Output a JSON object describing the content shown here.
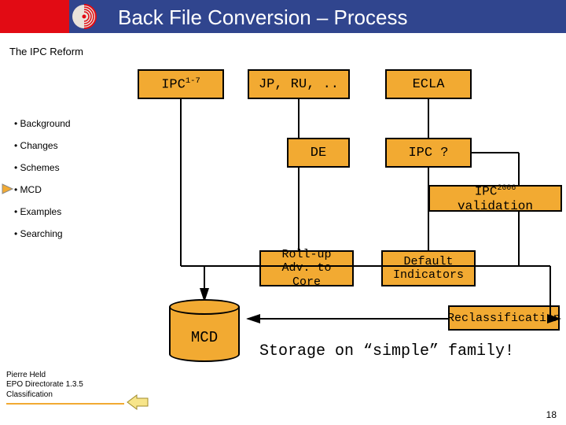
{
  "header": {
    "title": "Back File Conversion – Process",
    "subtitle": "The IPC Reform"
  },
  "sidebar": {
    "items": [
      {
        "label": "Background"
      },
      {
        "label": "Changes"
      },
      {
        "label": "Schemes"
      },
      {
        "label": "MCD"
      },
      {
        "label": "Examples"
      },
      {
        "label": "Searching"
      }
    ]
  },
  "nodes": {
    "ipc17_pre": "IPC",
    "ipc17_sup": "1-7",
    "jpru": "JP, RU, ..",
    "ecla": "ECLA",
    "de": "DE",
    "ipcq": "IPC ?",
    "ipc2006_pre": "IPC",
    "ipc2006_sup": "2006",
    "ipc2006_post": " validation",
    "rollup_l1": "Roll-up",
    "rollup_l2": "Adv. to Core",
    "default_l1": "Default",
    "default_l2": "Indicators",
    "reclass": "Reclassification",
    "mcd": "MCD"
  },
  "caption": "Storage on “simple” family!",
  "footer": {
    "l1": "Pierre Held",
    "l2": "EPO Directorate 1.3.5",
    "l3": "Classification"
  },
  "slide_number": "18",
  "icons": {
    "mcd_marker": "mcd-marker",
    "nav_back": "back-arrow"
  }
}
